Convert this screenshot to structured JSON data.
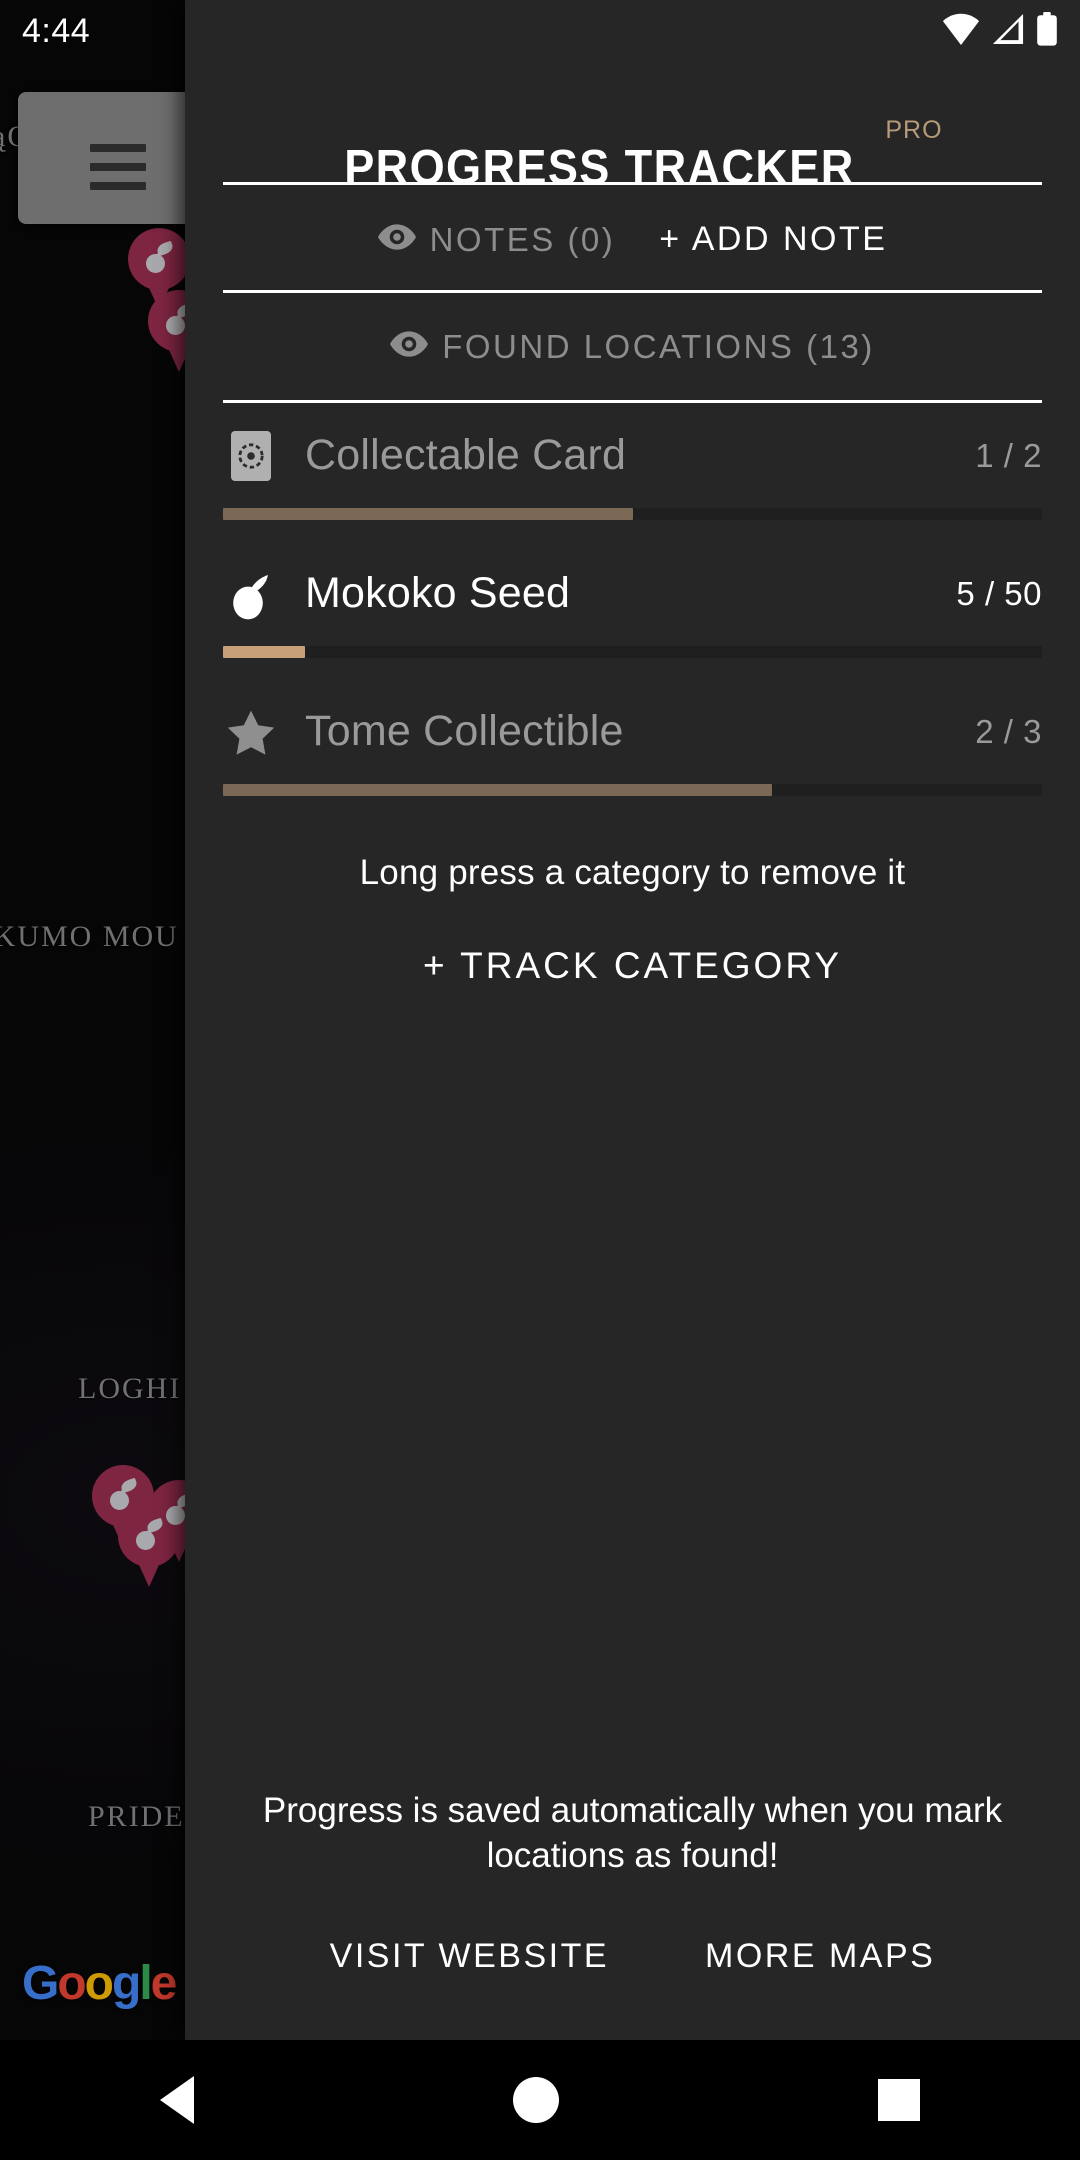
{
  "status_bar": {
    "time": "4:44",
    "icons": [
      "wifi-icon",
      "cellular-signal-icon",
      "battery-icon"
    ]
  },
  "map": {
    "menu_button_icon": "hamburger-menu-icon",
    "labels": [
      {
        "text": "ąO",
        "name": "map-label-topcut"
      },
      {
        "text": "NKUMO MOU",
        "name": "map-label-shikunkumo-mountain"
      },
      {
        "text": "LOGHI",
        "name": "map-label-loghill"
      },
      {
        "text": "PRIDEH",
        "name": "map-label-prideholme"
      }
    ],
    "pins": [
      "mokoko-seed-pin",
      "mokoko-seed-pin",
      "mokoko-seed-pin",
      "mokoko-seed-pin",
      "mokoko-seed-pin"
    ],
    "attribution": "Google"
  },
  "panel": {
    "title": "PROGRESS TRACKER",
    "pro_badge": "PRO",
    "notes": {
      "visibility_icon": "eye-icon",
      "label": "NOTES (0)",
      "add_button": "+ ADD NOTE"
    },
    "found_locations": {
      "visibility_icon": "eye-icon",
      "label": "FOUND LOCATIONS (13)"
    },
    "categories": [
      {
        "name": "Collectable Card",
        "icon": "card-icon",
        "count": "1 / 2",
        "found": 1,
        "total": 2,
        "percent": 50,
        "bar_color": "#7c6955",
        "active": false
      },
      {
        "name": "Mokoko Seed",
        "icon": "mokoko-seed-icon",
        "count": "5 / 50",
        "found": 5,
        "total": 50,
        "percent": 10,
        "bar_color": "#c6a078",
        "active": true
      },
      {
        "name": "Tome Collectible",
        "icon": "star-icon",
        "count": "2 / 3",
        "found": 2,
        "total": 3,
        "percent": 67,
        "bar_color": "#7c6955",
        "active": false
      }
    ],
    "hint": "Long press a category to remove it",
    "track_category_button": "+ TRACK CATEGORY",
    "save_note": "Progress is saved automatically when you mark locations as found!",
    "footer": {
      "visit_website": "VISIT WEBSITE",
      "more_maps": "MORE MAPS"
    }
  },
  "nav_bar": {
    "back": "back-icon",
    "home": "home-icon",
    "recents": "recents-icon"
  },
  "colors": {
    "panel_bg": "#262626",
    "accent_pro": "#b79a77",
    "accent_bar_active": "#c6a078",
    "accent_bar_dim": "#7c6955",
    "dim_text": "#8d8d8d",
    "pin": "#7d2541"
  }
}
